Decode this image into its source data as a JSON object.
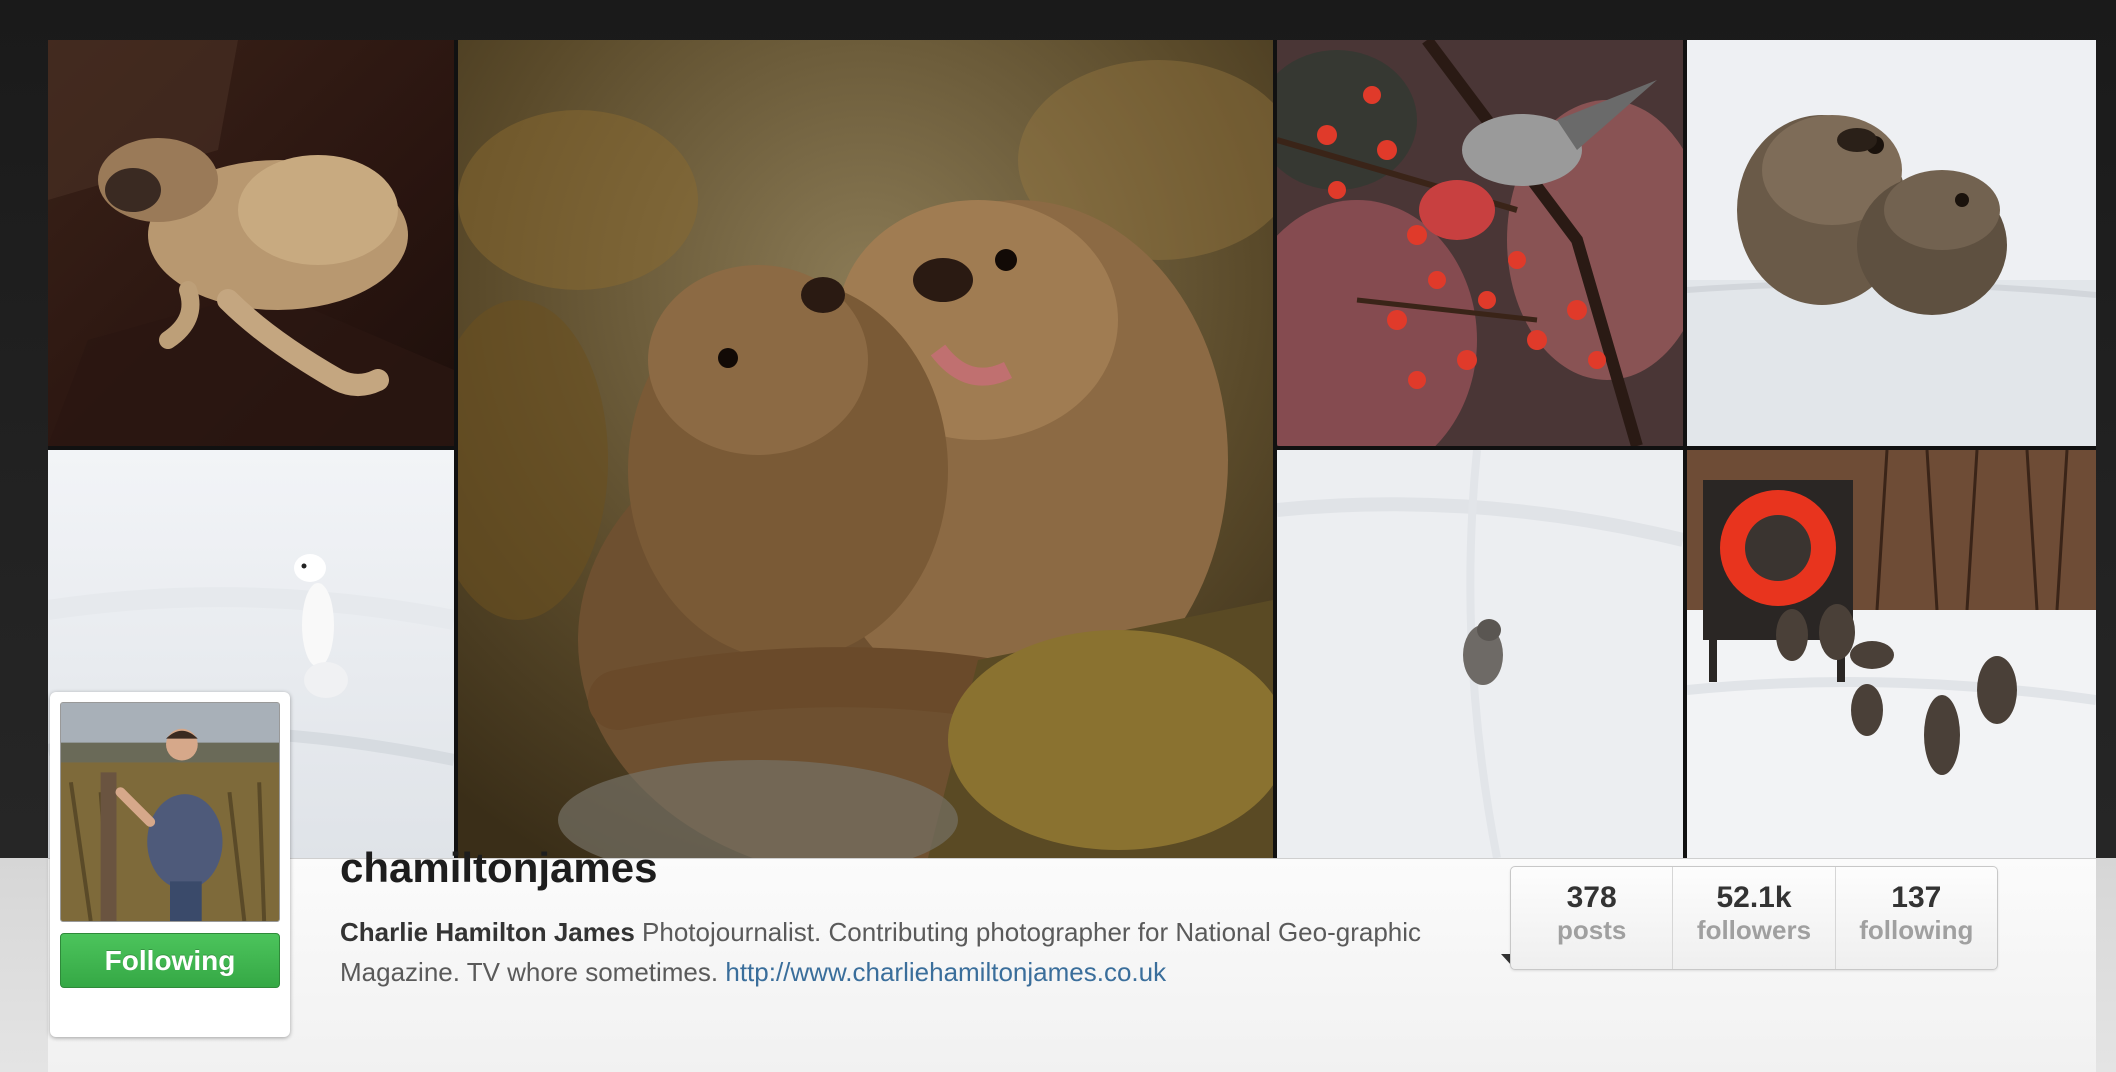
{
  "profile": {
    "username": "chamiltonjames",
    "full_name": "Charlie Hamilton James",
    "bio": "Photojournalist. Contributing photographer for National Geo-graphic Magazine. TV whore sometimes.",
    "website": "http://www.charliehamiltonjames.co.uk",
    "follow_button": "Following"
  },
  "stats": [
    {
      "value": "378",
      "label": "posts"
    },
    {
      "value": "52.1k",
      "label": "followers"
    },
    {
      "value": "137",
      "label": "following"
    }
  ],
  "icons": {
    "dropdown": "caret-down-icon"
  },
  "colors": {
    "follow_green": "#3fb551",
    "link_blue": "#3a6e9b"
  }
}
